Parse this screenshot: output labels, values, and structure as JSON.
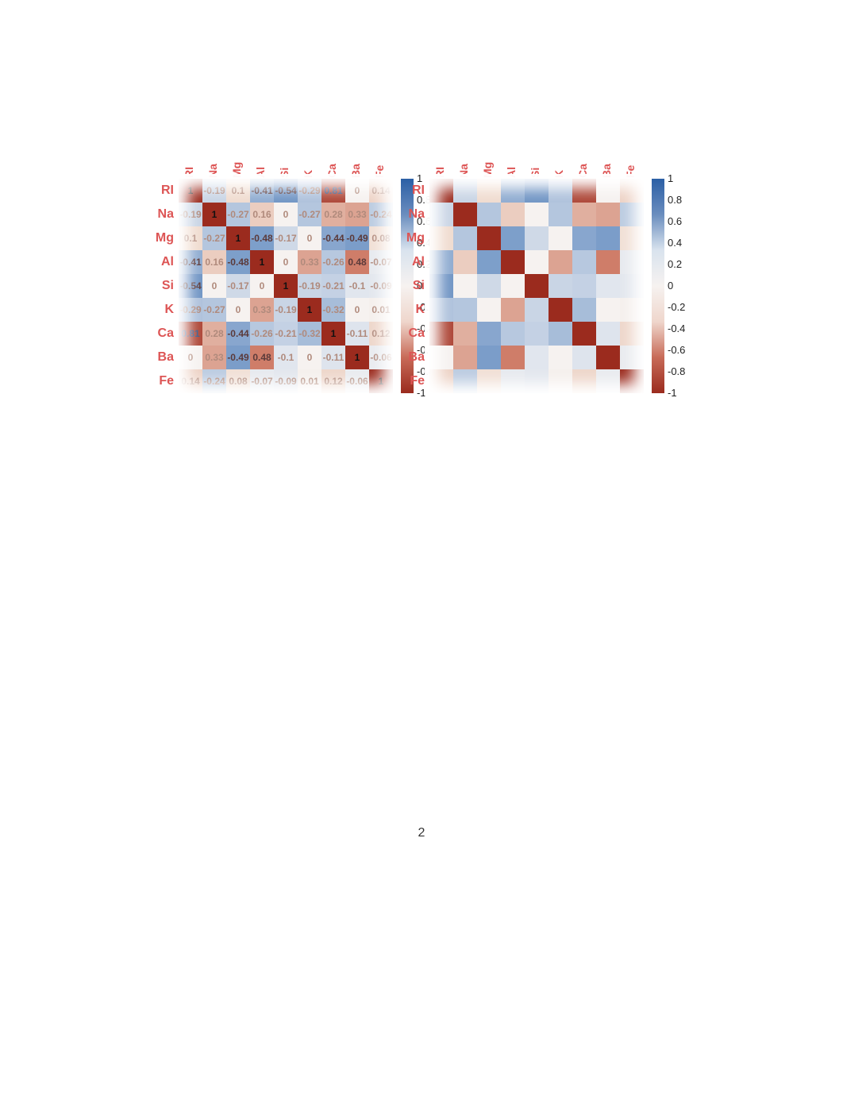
{
  "page_number": "2",
  "chart_data": [
    {
      "type": "heatmap",
      "show_values": true,
      "labels": [
        "RI",
        "Na",
        "Mg",
        "Al",
        "Si",
        "K",
        "Ca",
        "Ba",
        "Fe"
      ],
      "matrix": [
        [
          1,
          -0.19,
          0.1,
          -0.41,
          -0.54,
          -0.29,
          0.81,
          0,
          0.14
        ],
        [
          -0.19,
          1,
          -0.27,
          0.16,
          0,
          -0.27,
          0.28,
          0.33,
          -0.24
        ],
        [
          0.1,
          -0.27,
          1,
          -0.48,
          -0.17,
          0,
          -0.44,
          -0.49,
          0.08
        ],
        [
          -0.41,
          0.16,
          -0.48,
          1,
          0,
          0.33,
          -0.26,
          0.48,
          -0.07
        ],
        [
          -0.54,
          0,
          -0.17,
          0,
          1,
          -0.19,
          -0.21,
          -0.1,
          -0.09
        ],
        [
          -0.29,
          -0.27,
          0,
          0.33,
          -0.19,
          1,
          -0.32,
          0,
          0.01
        ],
        [
          0.81,
          0.28,
          -0.44,
          -0.26,
          -0.21,
          -0.32,
          1,
          -0.11,
          0.12
        ],
        [
          0,
          0.33,
          -0.49,
          0.48,
          -0.1,
          0,
          -0.11,
          1,
          -0.06
        ],
        [
          0.14,
          -0.24,
          0.08,
          -0.07,
          -0.09,
          0.01,
          0.12,
          -0.06,
          1
        ]
      ],
      "colorbar_ticks": [
        1,
        0.8,
        0.6,
        0.4,
        0.2,
        0,
        -0.2,
        -0.4,
        -0.6,
        -0.8,
        -1
      ],
      "vmin": -1,
      "vmax": 1
    },
    {
      "type": "heatmap",
      "show_values": false,
      "labels": [
        "RI",
        "Na",
        "Mg",
        "Al",
        "Si",
        "K",
        "Ca",
        "Ba",
        "Fe"
      ],
      "matrix": [
        [
          1,
          -0.19,
          0.1,
          -0.41,
          -0.54,
          -0.29,
          0.81,
          0,
          0.14
        ],
        [
          -0.19,
          1,
          -0.27,
          0.16,
          0,
          -0.27,
          0.28,
          0.33,
          -0.24
        ],
        [
          0.1,
          -0.27,
          1,
          -0.48,
          -0.17,
          0,
          -0.44,
          -0.49,
          0.08
        ],
        [
          -0.41,
          0.16,
          -0.48,
          1,
          0,
          0.33,
          -0.26,
          0.48,
          -0.07
        ],
        [
          -0.54,
          0,
          -0.17,
          0,
          1,
          -0.19,
          -0.21,
          -0.1,
          -0.09
        ],
        [
          -0.29,
          -0.27,
          0,
          0.33,
          -0.19,
          1,
          -0.32,
          0,
          0.01
        ],
        [
          0.81,
          0.28,
          -0.44,
          -0.26,
          -0.21,
          -0.32,
          1,
          -0.11,
          0.12
        ],
        [
          0,
          0.33,
          -0.49,
          0.48,
          -0.1,
          0,
          -0.11,
          1,
          -0.06
        ],
        [
          0.14,
          -0.24,
          0.08,
          -0.07,
          -0.09,
          0.01,
          0.12,
          -0.06,
          1
        ]
      ],
      "colorbar_ticks": [
        1,
        0.8,
        0.6,
        0.4,
        0.2,
        0,
        -0.2,
        -0.4,
        -0.6,
        -0.8,
        -1
      ],
      "vmin": -1,
      "vmax": 1
    }
  ]
}
